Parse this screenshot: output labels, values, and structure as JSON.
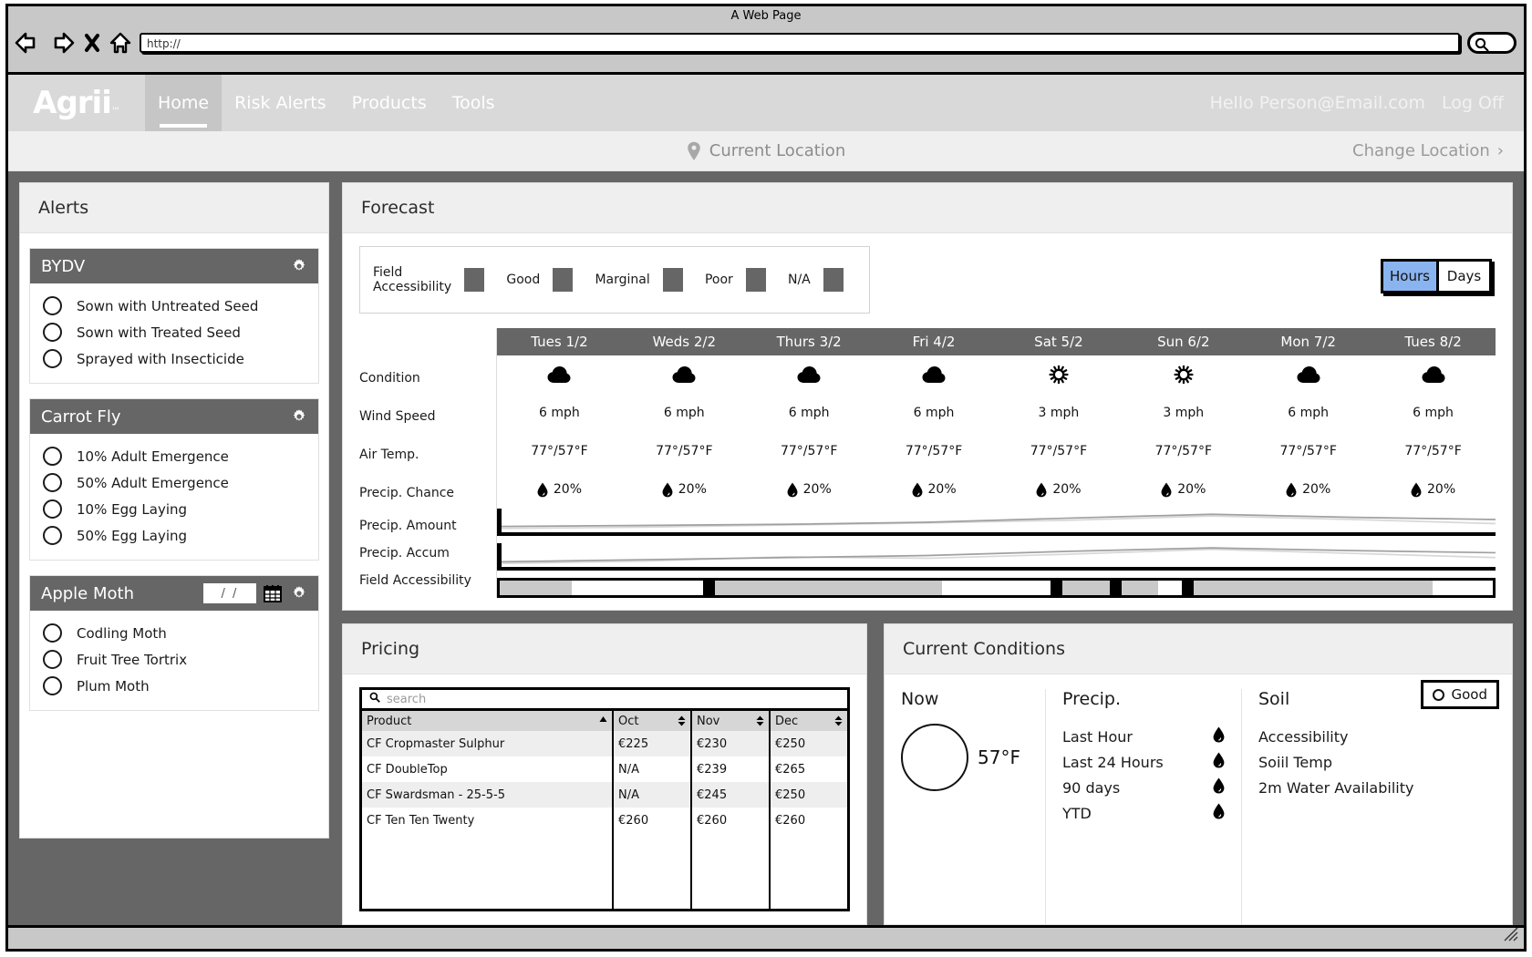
{
  "browser": {
    "window_title": "A Web Page",
    "url_value": "http://",
    "back_icon": "back-arrow-icon",
    "forward_icon": "forward-arrow-icon",
    "stop_icon": "close-x-icon",
    "home_icon": "home-icon",
    "search_icon": "search-icon"
  },
  "site": {
    "logo_text": "Agrii",
    "nav": [
      {
        "label": "Home",
        "active": true
      },
      {
        "label": "Risk Alerts",
        "active": false
      },
      {
        "label": "Products",
        "active": false
      },
      {
        "label": "Tools",
        "active": false
      }
    ],
    "greeting": "Hello Person@Email.com",
    "logoff": "Log Off"
  },
  "location_bar": {
    "current_location": "Current Location",
    "change_location": "Change Location",
    "chevron": "›"
  },
  "alerts": {
    "title": "Alerts",
    "cards": [
      {
        "title": "BYDV",
        "has_date": false,
        "items": [
          "Sown with Untreated Seed",
          "Sown with Treated Seed",
          "Sprayed with Insecticide"
        ]
      },
      {
        "title": "Carrot Fly",
        "has_date": false,
        "items": [
          "10% Adult Emergence",
          "50% Adult Emergence",
          "10% Egg Laying",
          "50% Egg Laying"
        ]
      },
      {
        "title": "Apple Moth",
        "has_date": true,
        "date_value": "/  /",
        "items": [
          "Codling Moth",
          "Fruit Tree Tortrix",
          "Plum Moth"
        ]
      }
    ]
  },
  "forecast": {
    "title": "Forecast",
    "legend": {
      "label": "Field Accessibility",
      "entries": [
        "Good",
        "Marginal",
        "Poor",
        "N/A"
      ],
      "swatch_color": "#666666"
    },
    "unit_toggle": {
      "options": [
        "Hours",
        "Days"
      ],
      "selected": "Hours",
      "active_color": "#8ab4f0"
    },
    "row_labels": [
      "Condition",
      "Wind Speed",
      "Air Temp.",
      "Precip. Chance",
      "Precip. Amount",
      "Precip. Accum",
      "Field Accessibility"
    ],
    "days": [
      "Tues 1/2",
      "Weds 2/2",
      "Thurs 3/2",
      "Fri 4/2",
      "Sat 5/2",
      "Sun 6/2",
      "Mon 7/2",
      "Tues 8/2"
    ],
    "condition": [
      "cloud",
      "cloud",
      "cloud",
      "cloud",
      "sun",
      "sun",
      "cloud",
      "cloud"
    ],
    "wind_speed": [
      "6 mph",
      "6 mph",
      "6 mph",
      "6 mph",
      "3 mph",
      "3 mph",
      "6 mph",
      "6 mph"
    ],
    "air_temp": [
      "77°/57°F",
      "77°/57°F",
      "77°/57°F",
      "77°/57°F",
      "77°/57°F",
      "77°/57°F",
      "77°/57°F",
      "77°/57°F"
    ],
    "precip_chance": [
      "20%",
      "20%",
      "20%",
      "20%",
      "20%",
      "20%",
      "20%",
      "20%"
    ],
    "accessibility_segments": [
      {
        "width": 6,
        "state": "good"
      },
      {
        "width": 11,
        "state": "na"
      },
      {
        "width": 1,
        "state": "divider"
      },
      {
        "width": 19,
        "state": "good"
      },
      {
        "width": 9,
        "state": "na"
      },
      {
        "width": 1,
        "state": "divider"
      },
      {
        "width": 4,
        "state": "good"
      },
      {
        "width": 1,
        "state": "divider"
      },
      {
        "width": 3,
        "state": "good"
      },
      {
        "width": 2,
        "state": "na"
      },
      {
        "width": 1,
        "state": "divider"
      },
      {
        "width": 20,
        "state": "good"
      },
      {
        "width": 5,
        "state": "na"
      }
    ]
  },
  "chart_data": [
    {
      "type": "line",
      "title": "Precip. Amount",
      "x": [
        "Tues 1/2",
        "Weds 2/2",
        "Thurs 3/2",
        "Fri 4/2",
        "Sat 5/2",
        "Sun 6/2",
        "Mon 7/2",
        "Tues 8/2"
      ],
      "series": [
        {
          "name": "light",
          "color": "#d8d8d8",
          "values": [
            4,
            8,
            14,
            20,
            28,
            40,
            30,
            18
          ]
        },
        {
          "name": "dark",
          "color": "#a0a0a0",
          "values": [
            10,
            13,
            16,
            22,
            34,
            45,
            36,
            30
          ]
        }
      ],
      "grid": false,
      "legend": "none"
    },
    {
      "type": "line",
      "title": "Precip. Accum",
      "x": [
        "Tues 1/2",
        "Weds 2/2",
        "Thurs 3/2",
        "Fri 4/2",
        "Sat 5/2",
        "Sun 6/2",
        "Mon 7/2",
        "Tues 8/2"
      ],
      "series": [
        {
          "name": "light",
          "color": "#d8d8d8",
          "values": [
            3,
            10,
            22,
            18,
            30,
            44,
            32,
            20
          ]
        },
        {
          "name": "dark",
          "color": "#a0a0a0",
          "values": [
            8,
            14,
            20,
            26,
            38,
            48,
            40,
            34
          ]
        }
      ],
      "grid": false,
      "legend": "none"
    }
  ],
  "pricing": {
    "title": "Pricing",
    "search_placeholder": "search",
    "search_value": "",
    "columns": [
      "Product",
      "Oct",
      "Nov",
      "Dec"
    ],
    "sorted_column": "Product",
    "sort_direction": "asc",
    "rows": [
      {
        "product": "CF Cropmaster Sulphur",
        "oct": "€225",
        "nov": "€230",
        "dec": "€250"
      },
      {
        "product": "CF DoubleTop",
        "oct": "N/A",
        "nov": "€239",
        "dec": "€265"
      },
      {
        "product": "CF Swardsman - 25-5-5",
        "oct": "N/A",
        "nov": "€245",
        "dec": "€250"
      },
      {
        "product": "CF Ten Ten Twenty",
        "oct": "€260",
        "nov": "€260",
        "dec": "€260"
      }
    ]
  },
  "current_conditions": {
    "title": "Current Conditions",
    "now": {
      "label": "Now",
      "temperature": "57°F"
    },
    "precip": {
      "label": "Precip.",
      "rows": [
        "Last Hour",
        "Last 24 Hours",
        "90 days",
        "YTD"
      ]
    },
    "soil": {
      "label": "Soil",
      "rows": [
        "Accessibility",
        "Soiil Temp",
        "2m Water Availability"
      ],
      "badge": "Good"
    }
  }
}
